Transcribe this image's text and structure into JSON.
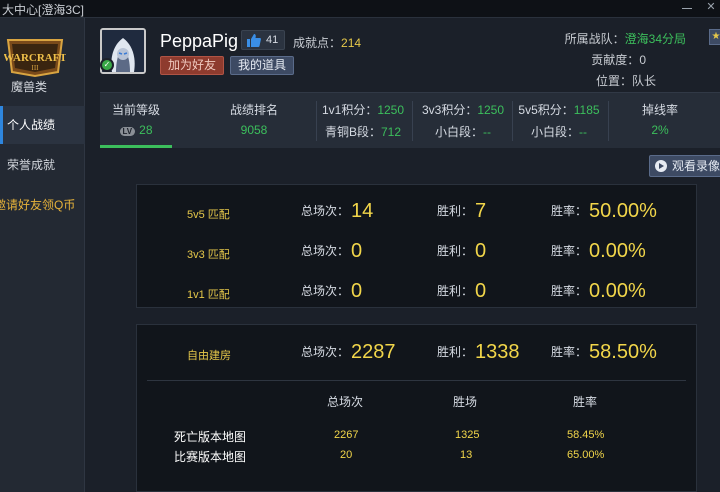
{
  "window": {
    "title": "大中心[澄海3C]"
  },
  "sidebar": {
    "items": [
      {
        "label": "魔兽类"
      },
      {
        "label": "个人战绩"
      },
      {
        "label": "荣誉成就"
      },
      {
        "label": "邀请好友领Q币"
      }
    ]
  },
  "profile": {
    "username": "PeppaPig",
    "likes": "41",
    "score_label": "成就点：",
    "score_value": "214",
    "add_friend_label": "加为好友",
    "my_items_label": "我的道具",
    "team_label": "所属战队：",
    "team_value": "澄海34分局",
    "contribution_label": "贡献度：",
    "contribution_value": "0",
    "position_label": "位置：",
    "position_value": "队长"
  },
  "stats_bar": {
    "level_label": "当前等级",
    "level_badge": "LV",
    "level_value": "28",
    "rank_label": "战绩排名",
    "rank_value": "9058",
    "v1_label": "1v1积分：",
    "v1_value": "1250",
    "v1_tier": "青铜B段：",
    "v1_tier_value": "712",
    "v3_label": "3v3积分：",
    "v3_value": "1250",
    "v3_tier": "小白段：",
    "v3_tier_value": "--",
    "v5_label": "5v5积分：",
    "v5_value": "1185",
    "v5_tier": "小白段：",
    "v5_tier_value": "--",
    "drop_label": "掉线率",
    "drop_value": "2%"
  },
  "replay_button": {
    "label": "观看录像"
  },
  "labels": {
    "total": "总场次：",
    "wins": "胜利：",
    "rate": "胜率："
  },
  "matches": [
    {
      "mode": "5v5 匹配",
      "total": "14",
      "wins": "7",
      "rate": "50.00%"
    },
    {
      "mode": "3v3 匹配",
      "total": "0",
      "wins": "0",
      "rate": "0.00%"
    },
    {
      "mode": "1v1 匹配",
      "total": "0",
      "wins": "0",
      "rate": "0.00%"
    }
  ],
  "custom": {
    "mode": "自由建房",
    "total": "2287",
    "wins": "1338",
    "rate": "58.50%",
    "headers": [
      "总场次",
      "胜场",
      "胜率"
    ],
    "rows": [
      {
        "name": "死亡版本地图",
        "total": "2267",
        "wins": "1325",
        "rate": "58.45%"
      },
      {
        "name": "比赛版本地图",
        "total": "20",
        "wins": "13",
        "rate": "65.00%"
      }
    ]
  }
}
